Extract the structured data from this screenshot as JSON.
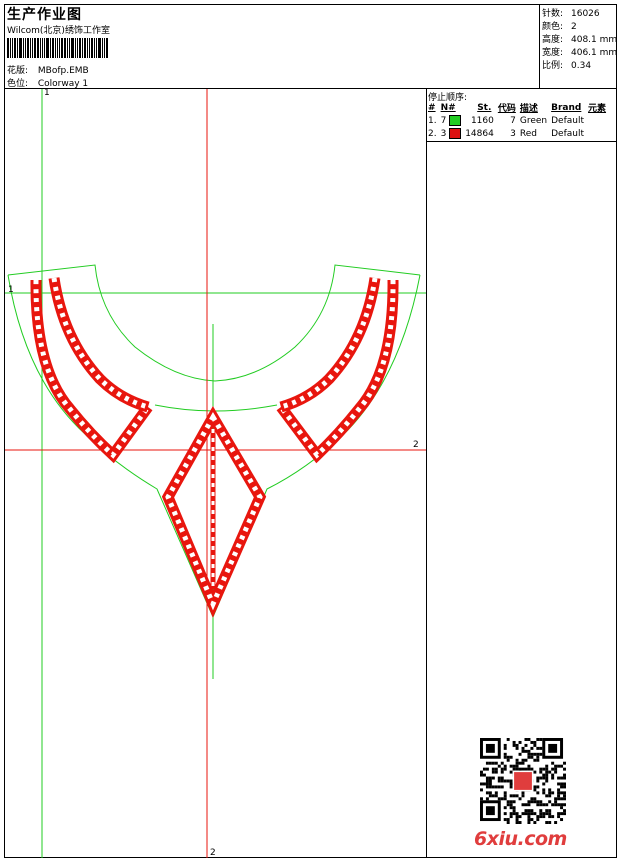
{
  "header": {
    "title": "生产作业图",
    "company": "Wilcom(北京)绣饰工作室",
    "design_label": "花版:",
    "design_value": "MBofp.EMB",
    "colorway_label": "色位:",
    "colorway_value": "Colorway 1"
  },
  "stats": [
    {
      "label": "针数:",
      "value": "16026"
    },
    {
      "label": "颜色:",
      "value": "2"
    },
    {
      "label": "高度:",
      "value": "408.1 mm"
    },
    {
      "label": "宽度:",
      "value": "406.1 mm"
    },
    {
      "label": "比例:",
      "value": "0.34"
    }
  ],
  "sequence": {
    "title": "停止顺序:",
    "columns": [
      "#",
      "N#",
      "St.",
      "代码",
      "描述",
      "Brand",
      "元素"
    ],
    "rows": [
      {
        "idx": "1.",
        "n": "7",
        "color": "#22cc22",
        "stitches": "1160",
        "code": "7",
        "desc": "Green",
        "brand": "Default",
        "element": ""
      },
      {
        "idx": "2.",
        "n": "3",
        "color": "#dd1111",
        "stitches": "14864",
        "code": "3",
        "desc": "Red",
        "brand": "Default",
        "element": ""
      }
    ]
  },
  "axes": {
    "v1": "1",
    "h1": "1",
    "h2": "2",
    "v2": "2"
  },
  "colors": {
    "green": "#22cc22",
    "red": "#e8160e",
    "border": "#000000"
  },
  "watermark": "6xiu.com"
}
